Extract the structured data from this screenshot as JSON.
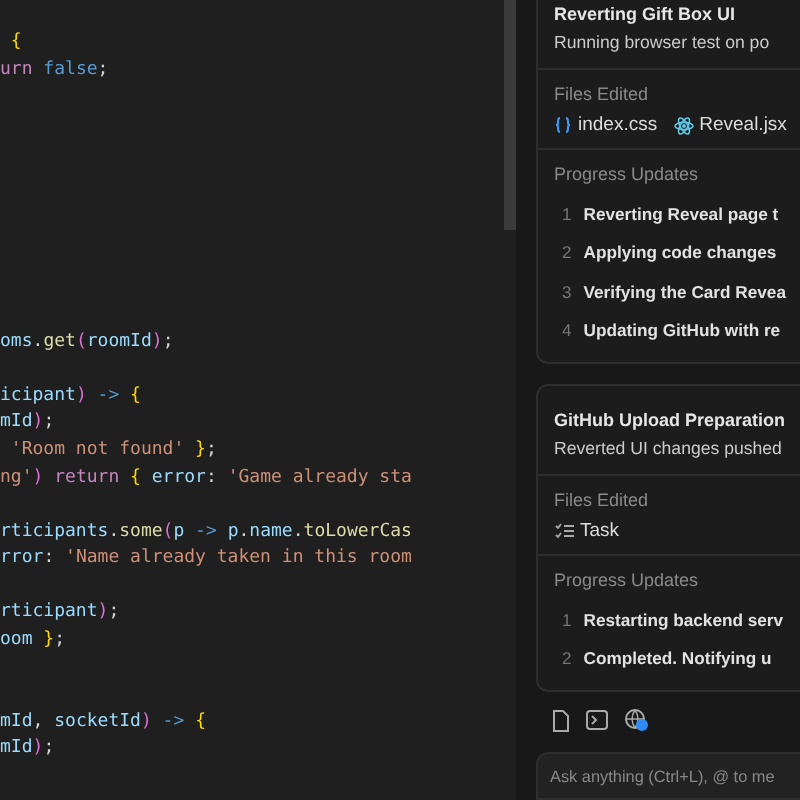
{
  "editor": {
    "lines": [
      {
        "kind": "code",
        "tokens": [
          {
            "text": " {",
            "kind": "brace"
          }
        ]
      },
      {
        "kind": "code",
        "tokens": [
          {
            "text": "urn",
            "kind": "kw"
          },
          {
            "text": " false",
            "kind": "const"
          },
          {
            "text": ";",
            "kind": "p"
          }
        ]
      },
      {
        "kind": "blank"
      },
      {
        "kind": "blank"
      },
      {
        "kind": "blank"
      },
      {
        "kind": "blank"
      },
      {
        "kind": "blank"
      },
      {
        "kind": "blank"
      },
      {
        "kind": "blank"
      },
      {
        "kind": "blank"
      },
      {
        "kind": "blank"
      },
      {
        "kind": "code",
        "tokens": [
          {
            "text": "oms",
            "kind": "var"
          },
          {
            "text": ".",
            "kind": "p"
          },
          {
            "text": "get",
            "kind": "fn"
          },
          {
            "text": "(",
            "kind": "paren"
          },
          {
            "text": "roomId",
            "kind": "var"
          },
          {
            "text": ")",
            "kind": "paren"
          },
          {
            "text": ";",
            "kind": "p"
          }
        ]
      },
      {
        "kind": "blank"
      },
      {
        "kind": "code",
        "tokens": [
          {
            "text": "icipant",
            "kind": "var"
          },
          {
            "text": ")",
            "kind": "paren"
          },
          {
            "text": " ->",
            "kind": "op"
          },
          {
            "text": " {",
            "kind": "brace"
          }
        ]
      },
      {
        "kind": "code",
        "tokens": [
          {
            "text": "mId",
            "kind": "var"
          },
          {
            "text": ")",
            "kind": "paren"
          },
          {
            "text": ";",
            "kind": "p"
          }
        ]
      },
      {
        "kind": "code",
        "tokens": [
          {
            "text": " 'Room not found'",
            "kind": "str"
          },
          {
            "text": " }",
            "kind": "brace"
          },
          {
            "text": ";",
            "kind": "p"
          }
        ]
      },
      {
        "kind": "code",
        "tokens": [
          {
            "text": "ng'",
            "kind": "str"
          },
          {
            "text": ")",
            "kind": "paren"
          },
          {
            "text": " return",
            "kind": "kw"
          },
          {
            "text": " {",
            "kind": "brace"
          },
          {
            "text": " error",
            "kind": "var"
          },
          {
            "text": ":",
            "kind": "p"
          },
          {
            "text": " 'Game already sta",
            "kind": "str"
          }
        ]
      },
      {
        "kind": "blank"
      },
      {
        "kind": "code",
        "tokens": [
          {
            "text": "rticipants",
            "kind": "var"
          },
          {
            "text": ".",
            "kind": "p"
          },
          {
            "text": "some",
            "kind": "fn"
          },
          {
            "text": "(",
            "kind": "paren"
          },
          {
            "text": "p",
            "kind": "var"
          },
          {
            "text": " ->",
            "kind": "op"
          },
          {
            "text": " p",
            "kind": "var"
          },
          {
            "text": ".",
            "kind": "p"
          },
          {
            "text": "name",
            "kind": "var"
          },
          {
            "text": ".",
            "kind": "p"
          },
          {
            "text": "toLowerCas",
            "kind": "fn"
          }
        ]
      },
      {
        "kind": "code",
        "tokens": [
          {
            "text": "rror",
            "kind": "var"
          },
          {
            "text": ":",
            "kind": "p"
          },
          {
            "text": " 'Name already taken in this room",
            "kind": "str"
          }
        ]
      },
      {
        "kind": "blank"
      },
      {
        "kind": "code",
        "tokens": [
          {
            "text": "rticipant",
            "kind": "var"
          },
          {
            "text": ")",
            "kind": "paren"
          },
          {
            "text": ";",
            "kind": "p"
          }
        ]
      },
      {
        "kind": "code",
        "tokens": [
          {
            "text": "oom",
            "kind": "var"
          },
          {
            "text": " }",
            "kind": "brace"
          },
          {
            "text": ";",
            "kind": "p"
          }
        ]
      },
      {
        "kind": "blank"
      },
      {
        "kind": "blank"
      },
      {
        "kind": "code",
        "tokens": [
          {
            "text": "mId",
            "kind": "var"
          },
          {
            "text": ",",
            "kind": "p"
          },
          {
            "text": " socketId",
            "kind": "var"
          },
          {
            "text": ")",
            "kind": "paren"
          },
          {
            "text": " ->",
            "kind": "op"
          },
          {
            "text": " {",
            "kind": "brace"
          }
        ]
      },
      {
        "kind": "code",
        "tokens": [
          {
            "text": "mId",
            "kind": "var"
          },
          {
            "text": ")",
            "kind": "paren"
          },
          {
            "text": ";",
            "kind": "p"
          }
        ]
      }
    ]
  },
  "tasks": [
    {
      "title": "Reverting Gift Box UI",
      "subtitle": "Running browser test on po",
      "files_heading": "Files Edited",
      "files": [
        {
          "name": "index.css",
          "kind": "css"
        },
        {
          "name": "Reveal.jsx",
          "kind": "react"
        }
      ],
      "progress_heading": "Progress Updates",
      "updates": [
        {
          "number": "1",
          "text": "Reverting Reveal page t"
        },
        {
          "number": "2",
          "text": "Applying code changes"
        },
        {
          "number": "3",
          "text": "Verifying the Card Revea"
        },
        {
          "number": "4",
          "text": "Updating GitHub with re"
        }
      ]
    },
    {
      "title": "GitHub Upload Preparation",
      "subtitle": "Reverted UI changes pushed",
      "files_heading": "Files Edited",
      "files": [
        {
          "name": "Task",
          "kind": "task"
        }
      ],
      "progress_heading": "Progress Updates",
      "updates": [
        {
          "number": "1",
          "text": "Restarting backend serv"
        },
        {
          "number": "2",
          "text": "Completed. Notifying u"
        }
      ]
    }
  ],
  "chat_input": {
    "placeholder": "Ask anything (Ctrl+L), @ to me"
  }
}
